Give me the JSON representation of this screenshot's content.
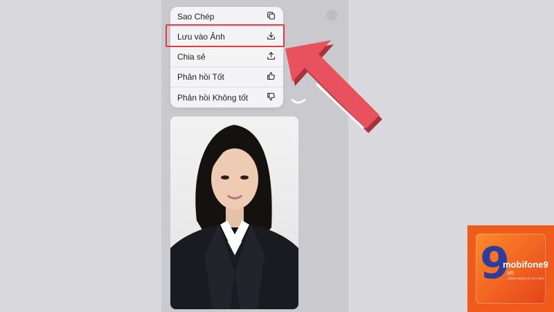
{
  "menu": {
    "items": [
      {
        "label": "Sao Chép",
        "icon": "copy-icon"
      },
      {
        "label": "Lưu vào Ảnh",
        "icon": "download-icon"
      },
      {
        "label": "Chia sẻ",
        "icon": "share-icon"
      },
      {
        "label": "Phản hồi Tốt",
        "icon": "thumbs-up-icon"
      },
      {
        "label": "Phản hồi Không tốt",
        "icon": "thumbs-down-icon"
      }
    ]
  },
  "annotation": {
    "color": "#e53945"
  },
  "watermark": {
    "brand": "mobifone9",
    "domain": ".vn",
    "tagline": "CÔNG NGHỆ VÀ KẾT NỐI"
  }
}
